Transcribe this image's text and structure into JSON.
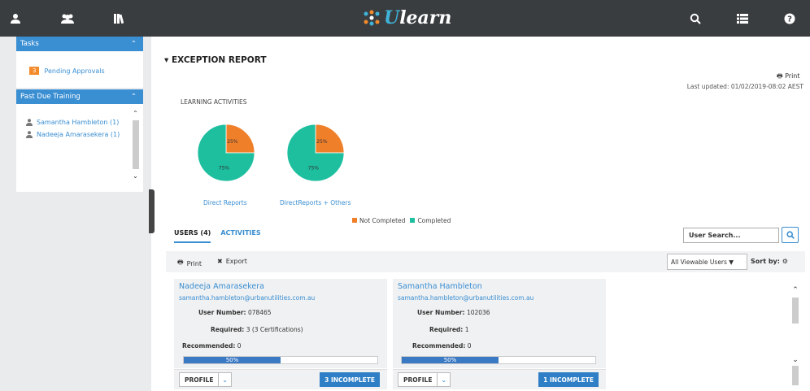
{
  "topbar": {
    "left_icons": [
      "user-icon",
      "users-icon",
      "library-icon"
    ],
    "right_icons": [
      "search-icon",
      "list-icon",
      "help-icon"
    ],
    "logo_prefix": "U",
    "logo_suffix": "learn"
  },
  "sidebar": {
    "tasks": {
      "title": "Tasks",
      "items": [
        {
          "badge": "3",
          "label": "Pending Approvals"
        }
      ]
    },
    "past_due": {
      "title": "Past Due Training",
      "items": [
        {
          "label": "Samantha Hambleton  (1)"
        },
        {
          "label": "Nadeeja Amarasekera  (1)"
        }
      ]
    }
  },
  "report": {
    "title": "EXCEPTION REPORT",
    "print_label": "Print",
    "last_updated": "Last updated: 01/02/2019-08:02 AEST",
    "section_label": "LEARNING ACTIVITIES"
  },
  "chart_data": [
    {
      "type": "pie",
      "title": "Direct Reports",
      "categories": [
        "Not Completed",
        "Completed"
      ],
      "values": [
        25,
        75
      ],
      "labels": [
        "25%",
        "75%"
      ],
      "colors": [
        "#f07f2a",
        "#1dbf9f"
      ]
    },
    {
      "type": "pie",
      "title": "DirectReports + Others",
      "categories": [
        "Not Completed",
        "Completed"
      ],
      "values": [
        25,
        75
      ],
      "labels": [
        "25%",
        "75%"
      ],
      "colors": [
        "#f07f2a",
        "#1dbf9f"
      ]
    }
  ],
  "legend": {
    "not_completed": "Not Completed",
    "completed": "Completed"
  },
  "tabs": {
    "users": "USERS (4)",
    "activities": "ACTIVITIES"
  },
  "search": {
    "placeholder": "User Search..."
  },
  "toolbar": {
    "print": "Print",
    "export": "Export",
    "filter_value": "All Viewable Users",
    "sort_label": "Sort by:"
  },
  "cards": [
    {
      "name": "Nadeeja Amarasekera",
      "email": "samantha.hambleton@urbanutilities.com.au",
      "user_number_label": "User Number:",
      "user_number": "078465",
      "required_label": "Required:",
      "required": "3 (3 Certifications)",
      "recommended_label": "Recommended:",
      "recommended": "0",
      "progress": 0.5,
      "progress_label": "50%",
      "profile_label": "PROFILE",
      "incomplete_label": "3 INCOMPLETE"
    },
    {
      "name": "Samantha Hambleton",
      "email": "samantha.hambleton@urbanutilities.com.au",
      "user_number_label": "User Number:",
      "user_number": "102036",
      "required_label": "Required:",
      "required": "1",
      "recommended_label": "Recommended:",
      "recommended": "0",
      "progress": 0.5,
      "progress_label": "50%",
      "profile_label": "PROFILE",
      "incomplete_label": "1 INCOMPLETE"
    }
  ],
  "colors": {
    "topbar": "#3a3d40",
    "accent": "#3a8ed2",
    "not_completed": "#f07f2a",
    "completed": "#1dbf9f",
    "badge": "#f38b2c"
  }
}
